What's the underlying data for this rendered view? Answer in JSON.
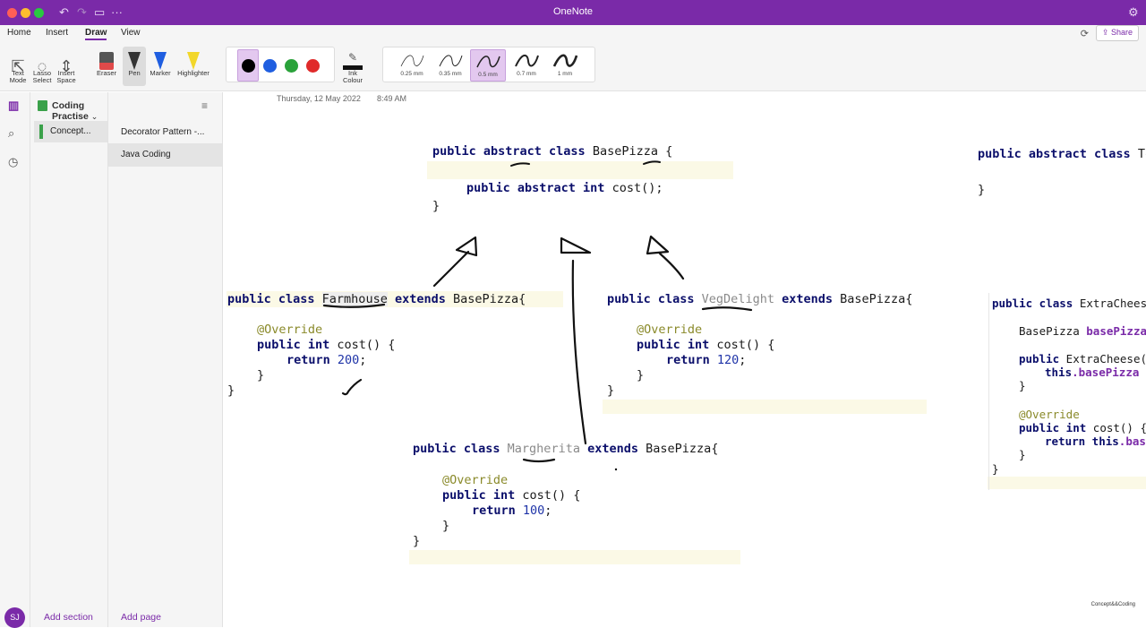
{
  "window": {
    "title": "OneNote"
  },
  "ribbon_tabs": [
    "Home",
    "Insert",
    "Draw",
    "View"
  ],
  "active_tab": "Draw",
  "share_label": "Share",
  "tools": [
    {
      "label": "Text\nMode",
      "icon": "text-mode-icon"
    },
    {
      "label": "Lasso\nSelect",
      "icon": "lasso-icon"
    },
    {
      "label": "Insert\nSpace",
      "icon": "insert-space-icon"
    },
    {
      "label": "Eraser",
      "icon": "eraser-icon"
    },
    {
      "label": "Pen",
      "icon": "pen-icon"
    },
    {
      "label": "Marker",
      "icon": "marker-icon"
    },
    {
      "label": "Highlighter",
      "icon": "highlighter-icon"
    }
  ],
  "ink_colour_label": "Ink\nColour",
  "colors": [
    "#000000",
    "#1f5ee0",
    "#2aa23a",
    "#e02a2a"
  ],
  "thicknesses": [
    "0.25 mm",
    "0.35 mm",
    "0.5 mm",
    "0.7 mm",
    "1 mm"
  ],
  "selected_thickness": "0.5 mm",
  "notebook": {
    "name": "Coding Practise"
  },
  "sections": [
    {
      "label": "Concept..."
    }
  ],
  "pages": [
    {
      "label": "Decorator Pattern -..."
    },
    {
      "label": "Java Coding"
    }
  ],
  "footer": {
    "add_section": "Add section",
    "add_page": "Add page",
    "avatar": "SJ"
  },
  "page_meta": {
    "date": "Thursday, 12 May 2022",
    "time": "8:49 AM"
  },
  "code_blocks": {
    "base": {
      "line1_kw": "public abstract class",
      "line1_name": "BasePizza",
      "line1_end": " {",
      "line2_kw": "public abstract int",
      "line2_rest": " cost();",
      "line3": "}"
    },
    "farmhouse": {
      "kw1": "public class ",
      "name": "Farmhouse",
      "kw2": " extends ",
      "base": "BasePizza{",
      "annotation": "@Override",
      "sig_kw": "public int",
      "sig_rest": " cost() {",
      "ret_kw": "return ",
      "ret_val": "200",
      "ret_end": ";",
      "close1": "}",
      "close2": "}"
    },
    "vegdelight": {
      "kw1": "public class ",
      "name": "VegDelight",
      "kw2": " extends ",
      "base": "BasePizza{",
      "annotation": "@Override",
      "sig_kw": "public int",
      "sig_rest": " cost() {",
      "ret_kw": "return ",
      "ret_val": "120",
      "ret_end": ";",
      "close1": "}",
      "close2": "}"
    },
    "margherita": {
      "kw1": "public class ",
      "name": "Margherita",
      "kw2": " extends ",
      "base": "BasePizza{",
      "annotation": "@Override",
      "sig_kw": "public int",
      "sig_rest": " cost() {",
      "ret_kw": "return ",
      "ret_val": "100",
      "ret_end": ";",
      "close1": "}",
      "close2": "}"
    },
    "topping": {
      "line1_kw": "public abstract class",
      "line1_name": " Top",
      "line2": "}"
    },
    "extracheese": {
      "l1_kw": "public class",
      "l1_name": " ExtraChees",
      "l2_type": "BasePizza ",
      "l2_field": "basePizza",
      "l3_kw": "public",
      "l3_rest": " ExtraCheese(",
      "l4_kw": "this",
      "l4_rest": ".basePizza =",
      "l5": "}",
      "annotation": "@Override",
      "l7_kw": "public int",
      "l7_rest": " cost() {",
      "l8_kw": "return this",
      "l8_rest": ".base",
      "l9": "}",
      "l10": "}"
    }
  },
  "watermark": "Concept&&Coding"
}
